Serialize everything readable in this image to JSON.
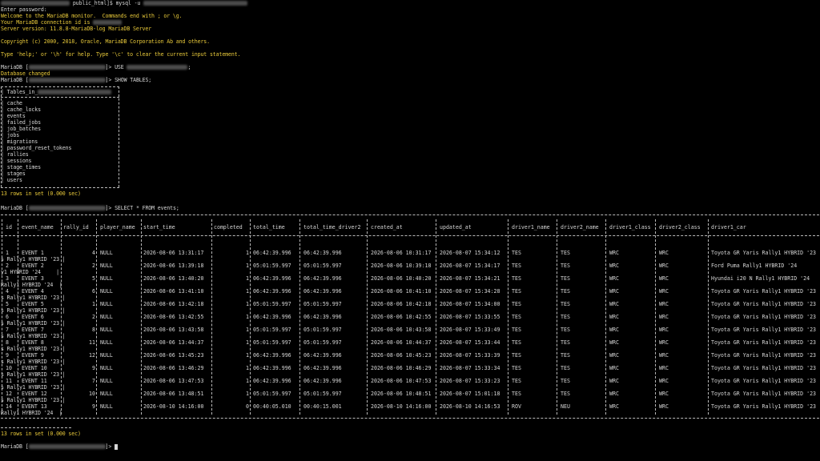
{
  "session": {
    "shell_prompt": "public_html]$ mysql -u",
    "enter_password": "Enter password:",
    "welcome": "Welcome to the MariaDB monitor.  Commands end with ; or \\g.",
    "conn_id": "Your MariaDB connection id is",
    "server_version": "Server version: 11.8.8-MariaDB-log MariaDB Server",
    "copyright": "Copyright (c) 2000, 2018, Oracle, MariaDB Corporation Ab and others.",
    "help": "Type 'help;' or '\\h' for help. Type '\\c' to clear the current input statement.",
    "prompt_prefix": "MariaDB [",
    "prompt_suffix": "]>",
    "use_cmd": "USE",
    "semicolon": ";",
    "db_changed": "Database changed",
    "show_tables_cmd": "SHOW TABLES;",
    "tables_header": "| Tables_in_",
    "tables": [
      "cache",
      "cache_locks",
      "events",
      "failed_jobs",
      "job_batches",
      "jobs",
      "migrations",
      "password_reset_tokens",
      "rallies",
      "sessions",
      "stage_times",
      "stages",
      "users"
    ],
    "tables_rowcount": "13 rows in set (0.000 sec)",
    "select_cmd": "SELECT * FROM events;",
    "events_rowcount": "13 rows in set (0.000 sec)"
  },
  "events_table": {
    "columns": [
      "id",
      "event_name",
      "rally_id",
      "player_name",
      "start_time",
      "completed",
      "total_time",
      "total_time_driver2",
      "created_at",
      "updated_at",
      "driver1_name",
      "driver2_name",
      "driver1_class",
      "driver2_class",
      "driver1_car"
    ],
    "rows": [
      {
        "id": "1",
        "event_name": "EVENT 1",
        "rally_id": "4",
        "player_name": "NULL",
        "start_time": "2026-08-06 13:31:17",
        "completed": "1",
        "total_time": "06:42:39.996",
        "total_time_driver2": "06:42:39.996",
        "created_at": "2026-08-06 10:31:17",
        "updated_at": "2026-08-07 15:34:12",
        "driver1_name": "TES",
        "driver2_name": "TES",
        "driver1_class": "WRC",
        "driver2_class": "WRC",
        "driver1_car": "Toyota GR Yaris Rally1 HYBRID '23",
        "wrap": "s Rally1 HYBRID '23 |"
      },
      {
        "id": "2",
        "event_name": "EVENT 2",
        "rally_id": "2",
        "player_name": "NULL",
        "start_time": "2026-08-06 13:39:18",
        "completed": "1",
        "total_time": "05:01:59.997",
        "total_time_driver2": "05:01:59.997",
        "created_at": "2026-08-06 10:39:18",
        "updated_at": "2026-08-07 15:34:17",
        "driver1_name": "TES",
        "driver2_name": "TES",
        "driver1_class": "WRC",
        "driver2_class": "WRC",
        "driver1_car": "Ford Puma Rally1 HYBRID '24",
        "wrap": "y1 HYBRID '24     |"
      },
      {
        "id": "3",
        "event_name": "EVENT 3",
        "rally_id": "5",
        "player_name": "NULL",
        "start_time": "2026-08-06 13:40:20",
        "completed": "1",
        "total_time": "06:42:39.996",
        "total_time_driver2": "06:42:39.996",
        "created_at": "2026-08-06 10:40:20",
        "updated_at": "2026-08-07 15:34:21",
        "driver1_name": "TES",
        "driver2_name": "TES",
        "driver1_class": "WRC",
        "driver2_class": "WRC",
        "driver1_car": "Hyundai i20 N Rally1 HYBRID '24",
        "wrap": "Rally1 HYBRID '24  |"
      },
      {
        "id": "4",
        "event_name": "EVENT 4",
        "rally_id": "6",
        "player_name": "NULL",
        "start_time": "2026-08-06 13:41:10",
        "completed": "1",
        "total_time": "06:42:39.996",
        "total_time_driver2": "06:42:39.996",
        "created_at": "2026-08-06 10:41:10",
        "updated_at": "2026-08-07 15:34:28",
        "driver1_name": "TES",
        "driver2_name": "TES",
        "driver1_class": "WRC",
        "driver2_class": "WRC",
        "driver1_car": "Toyota GR Yaris Rally1 HYBRID '23",
        "wrap": "s Rally1 HYBRID '23 |"
      },
      {
        "id": "5",
        "event_name": "EVENT 5",
        "rally_id": "1",
        "player_name": "NULL",
        "start_time": "2026-08-06 13:42:18",
        "completed": "1",
        "total_time": "05:01:59.997",
        "total_time_driver2": "05:01:59.997",
        "created_at": "2026-08-06 10:42:18",
        "updated_at": "2026-08-07 15:34:00",
        "driver1_name": "TES",
        "driver2_name": "TES",
        "driver1_class": "WRC",
        "driver2_class": "WRC",
        "driver1_car": "Toyota GR Yaris Rally1 HYBRID '23",
        "wrap": "s Rally1 HYBRID '23 |"
      },
      {
        "id": "6",
        "event_name": "EVENT 6",
        "rally_id": "2",
        "player_name": "NULL",
        "start_time": "2026-08-06 13:42:55",
        "completed": "1",
        "total_time": "06:42:39.996",
        "total_time_driver2": "06:42:39.996",
        "created_at": "2026-08-06 10:42:55",
        "updated_at": "2026-08-07 15:33:55",
        "driver1_name": "TES",
        "driver2_name": "TES",
        "driver1_class": "WRC",
        "driver2_class": "WRC",
        "driver1_car": "Toyota GR Yaris Rally1 HYBRID '23",
        "wrap": "s Rally1 HYBRID '23 |"
      },
      {
        "id": "7",
        "event_name": "EVENT 7",
        "rally_id": "8",
        "player_name": "NULL",
        "start_time": "2026-08-06 13:43:58",
        "completed": "1",
        "total_time": "05:01:59.997",
        "total_time_driver2": "05:01:59.997",
        "created_at": "2026-08-06 10:43:58",
        "updated_at": "2026-08-07 15:33:49",
        "driver1_name": "TES",
        "driver2_name": "TES",
        "driver1_class": "WRC",
        "driver2_class": "WRC",
        "driver1_car": "Toyota GR Yaris Rally1 HYBRID '23",
        "wrap": "s Rally1 HYBRID '23 |"
      },
      {
        "id": "8",
        "event_name": "EVENT 8",
        "rally_id": "11",
        "player_name": "NULL",
        "start_time": "2026-08-06 13:44:37",
        "completed": "1",
        "total_time": "05:01:59.997",
        "total_time_driver2": "05:01:59.997",
        "created_at": "2026-08-06 10:44:37",
        "updated_at": "2026-08-07 15:33:44",
        "driver1_name": "TES",
        "driver2_name": "TES",
        "driver1_class": "WRC",
        "driver2_class": "WRC",
        "driver1_car": "Toyota GR Yaris Rally1 HYBRID '23",
        "wrap": "s Rally1 HYBRID '23 |"
      },
      {
        "id": "9",
        "event_name": "EVENT 9",
        "rally_id": "12",
        "player_name": "NULL",
        "start_time": "2026-08-06 13:45:23",
        "completed": "1",
        "total_time": "06:42:39.996",
        "total_time_driver2": "06:42:39.996",
        "created_at": "2026-08-06 10:45:23",
        "updated_at": "2026-08-07 15:33:39",
        "driver1_name": "TES",
        "driver2_name": "TES",
        "driver1_class": "WRC",
        "driver2_class": "WRC",
        "driver1_car": "Toyota GR Yaris Rally1 HYBRID '23",
        "wrap": "s Rally1 HYBRID '23 |"
      },
      {
        "id": "10",
        "event_name": "EVENT 10",
        "rally_id": "9",
        "player_name": "NULL",
        "start_time": "2026-08-06 13:46:29",
        "completed": "1",
        "total_time": "06:42:39.996",
        "total_time_driver2": "06:42:39.996",
        "created_at": "2026-08-06 10:46:29",
        "updated_at": "2026-08-07 15:33:34",
        "driver1_name": "TES",
        "driver2_name": "TES",
        "driver1_class": "WRC",
        "driver2_class": "WRC",
        "driver1_car": "Toyota GR Yaris Rally1 HYBRID '23",
        "wrap": "s Rally1 HYBRID '23 |"
      },
      {
        "id": "11",
        "event_name": "EVENT 11",
        "rally_id": "7",
        "player_name": "NULL",
        "start_time": "2026-08-06 13:47:53",
        "completed": "1",
        "total_time": "06:42:39.996",
        "total_time_driver2": "06:42:39.996",
        "created_at": "2026-08-06 10:47:53",
        "updated_at": "2026-08-07 15:33:23",
        "driver1_name": "TES",
        "driver2_name": "TES",
        "driver1_class": "WRC",
        "driver2_class": "WRC",
        "driver1_car": "Toyota GR Yaris Rally1 HYBRID '23",
        "wrap": "s Rally1 HYBRID '23 |"
      },
      {
        "id": "12",
        "event_name": "EVENT 12",
        "rally_id": "10",
        "player_name": "NULL",
        "start_time": "2026-08-06 13:48:51",
        "completed": "1",
        "total_time": "05:01:59.997",
        "total_time_driver2": "05:01:59.997",
        "created_at": "2026-08-06 10:48:51",
        "updated_at": "2026-08-07 15:01:18",
        "driver1_name": "TES",
        "driver2_name": "TES",
        "driver1_class": "WRC",
        "driver2_class": "WRC",
        "driver1_car": "Toyota GR Yaris Rally1 HYBRID '23",
        "wrap": "s Rally1 HYBRID '23 |"
      },
      {
        "id": "14",
        "event_name": "EVENT 13",
        "rally_id": "9",
        "player_name": "NULL",
        "start_time": "2026-08-10 14:16:00",
        "completed": "0",
        "total_time": "00:40:05.010",
        "total_time_driver2": "00:40:15.001",
        "created_at": "2026-08-10 14:16:00",
        "updated_at": "2026-08-10 14:16:53",
        "driver1_name": "ROV",
        "driver2_name": "NEU",
        "driver1_class": "WRC",
        "driver2_class": "WRC",
        "driver1_car": "Toyota GR Yaris Rally1 HYBRID '23",
        "wrap": "Rally1 HYBRID '24  |"
      }
    ]
  },
  "colors": {
    "background": "#000000",
    "text": "#d6d6d6",
    "highlight": "#e8c93a",
    "redaction": "#5a5a5a"
  }
}
